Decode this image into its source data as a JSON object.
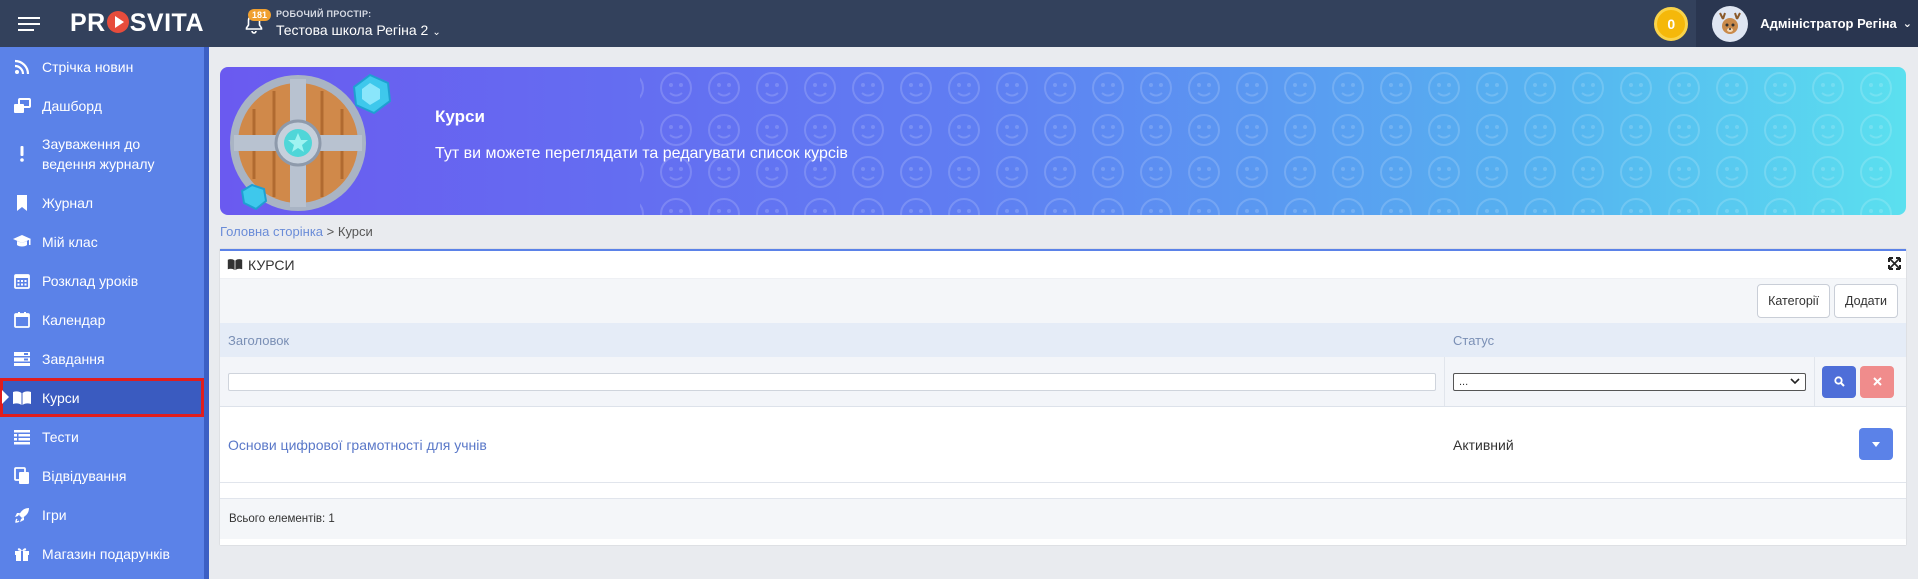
{
  "header": {
    "logo": {
      "pre": "PR",
      "post": "SVITA"
    },
    "notifications_count": "181",
    "workspace_label": "РОБОЧИЙ ПРОСТІР:",
    "workspace_name": "Тестова школа Регіна 2",
    "coins": "0",
    "user_name": "Адміністратор Регіна"
  },
  "sidebar": {
    "items": [
      {
        "label": "Стрічка новин",
        "icon": "rss-icon"
      },
      {
        "label": "Дашборд",
        "icon": "dashboard-icon"
      },
      {
        "label": "Зауваження до ведення журналу",
        "icon": "exclamation-icon"
      },
      {
        "label": "Журнал",
        "icon": "bookmark-icon"
      },
      {
        "label": "Мій клас",
        "icon": "graduation-cap-icon"
      },
      {
        "label": "Розклад уроків",
        "icon": "calendar-grid-icon"
      },
      {
        "label": "Календар",
        "icon": "calendar-icon"
      },
      {
        "label": "Завдання",
        "icon": "tasks-icon"
      },
      {
        "label": "Курси",
        "icon": "book-open-icon",
        "active": true
      },
      {
        "label": "Тести",
        "icon": "list-icon"
      },
      {
        "label": "Відвідування",
        "icon": "copy-icon"
      },
      {
        "label": "Ігри",
        "icon": "rocket-icon"
      },
      {
        "label": "Магазин подарунків",
        "icon": "gift-icon"
      }
    ]
  },
  "banner": {
    "title": "Курси",
    "subtitle": "Тут ви можете переглядати та редагувати список курсів"
  },
  "breadcrumb": {
    "home": "Головна сторінка",
    "separator": " > ",
    "current": "Курси"
  },
  "panel": {
    "title": "КУРСИ",
    "buttons": {
      "categories": "Категорії",
      "add": "Додати"
    },
    "columns": {
      "title": "Заголовок",
      "status": "Статус"
    },
    "filter": {
      "title_value": "",
      "status_value": "..."
    },
    "rows": [
      {
        "title": "Основи цифрової грамотності для учнів",
        "status": "Активний"
      }
    ],
    "footer": "Всього елементів: 1"
  },
  "colors": {
    "topbar": "#33415c",
    "sidebar": "#5b82e8",
    "sidebar_active": "#3a5bc0",
    "active_outline": "#e01d1d",
    "accent": "#4e6ed8",
    "coin": "#f5b80a"
  }
}
